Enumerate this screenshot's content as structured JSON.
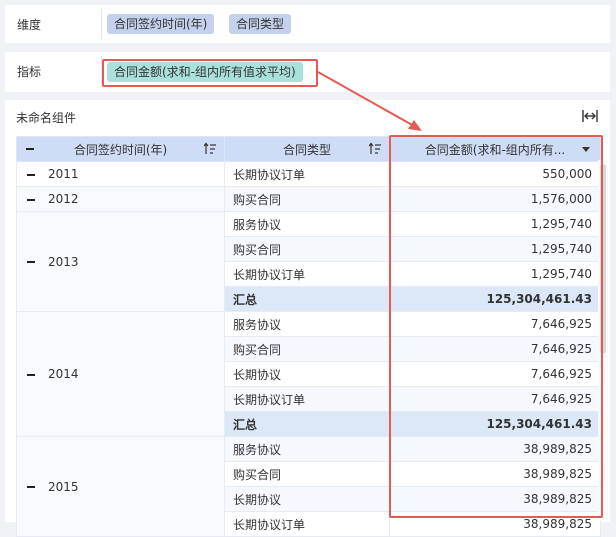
{
  "dimension_bar": {
    "label": "维度",
    "pills": [
      "合同签约时间(年)",
      "合同类型"
    ]
  },
  "metric_bar": {
    "label": "指标",
    "pill": "合同金额(求和-组内所有值求平均)"
  },
  "widget": {
    "title": "未命名组件",
    "columns": [
      "合同签约时间(年)",
      "合同类型",
      "合同金额(求和-组内所有..."
    ]
  },
  "rows": [
    {
      "year": "2011",
      "type": "长期协议订单",
      "value": "550,000"
    },
    {
      "year": "2012",
      "type": "购买合同",
      "value": "1,576,000"
    },
    {
      "year": "2013",
      "type": "服务协议",
      "value": "1,295,740"
    },
    {
      "year": "",
      "type": "购买合同",
      "value": "1,295,740"
    },
    {
      "year": "",
      "type": "长期协议订单",
      "value": "1,295,740"
    },
    {
      "year": "",
      "type": "汇总",
      "value": "125,304,461.43",
      "total": true
    },
    {
      "year": "2014",
      "type": "服务协议",
      "value": "7,646,925"
    },
    {
      "year": "",
      "type": "购买合同",
      "value": "7,646,925"
    },
    {
      "year": "",
      "type": "长期协议",
      "value": "7,646,925"
    },
    {
      "year": "",
      "type": "长期协议订单",
      "value": "7,646,925"
    },
    {
      "year": "",
      "type": "汇总",
      "value": "125,304,461.43",
      "total": true
    },
    {
      "year": "2015",
      "type": "服务协议",
      "value": "38,989,825"
    },
    {
      "year": "",
      "type": "购买合同",
      "value": "38,989,825"
    },
    {
      "year": "",
      "type": "长期协议",
      "value": "38,989,825"
    },
    {
      "year": "",
      "type": "长期协议订单",
      "value": "38,989,825"
    }
  ],
  "colors": {
    "annotation_red": "#e25b54",
    "dimension_pill": "#c5d1ec",
    "metric_pill": "#a9e2da",
    "header_bg": "#cfdcf6",
    "total_row_bg": "#dce7f7"
  }
}
